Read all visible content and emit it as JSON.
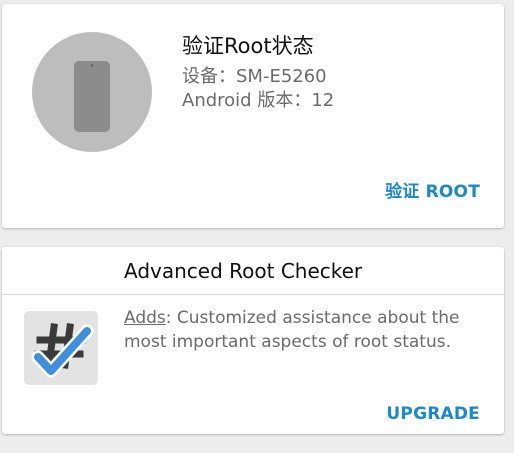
{
  "root_card": {
    "title": "验证Root状态",
    "device_label": "设备：",
    "device_value": "SM-E5260",
    "android_label": "Android 版本：",
    "android_value": "12",
    "verify_button": "验证 ROOT",
    "device_icon": "phone-icon"
  },
  "promo_card": {
    "title": "Advanced Root Checker",
    "desc_lead": "Adds",
    "desc_text": ": Customized assistance about the most important aspects of root status.",
    "upgrade_button": "UPGRADE",
    "app_icon": "root-checker-hash-check-icon"
  },
  "colors": {
    "accent": "#1e88c7",
    "circle_bg": "#bdbdbd",
    "phone_body": "#8c8c8c",
    "check_blue": "#3f8fdb",
    "hash_dark": "#3a3a3a"
  }
}
